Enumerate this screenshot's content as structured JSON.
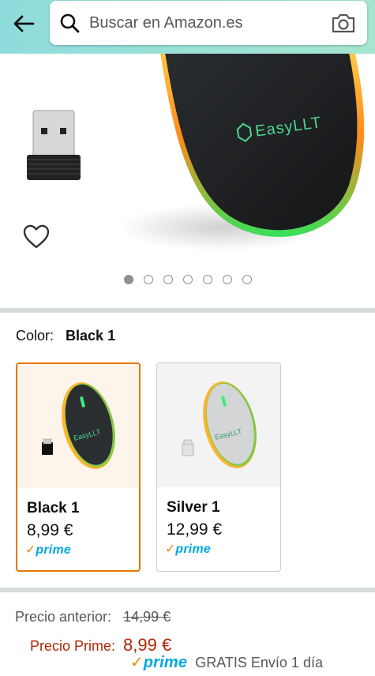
{
  "header": {
    "search_placeholder": "Buscar en Amazon.es"
  },
  "gallery": {
    "image_count": 7,
    "active_index": 0,
    "brand_mark": "EasyLLT"
  },
  "color": {
    "label": "Color:",
    "selected": "Black 1"
  },
  "variants": [
    {
      "name": "Black 1",
      "price": "8,99 €",
      "prime": "prime",
      "selected": true
    },
    {
      "name": "Silver 1",
      "price": "12,99 €",
      "prime": "prime",
      "selected": false
    }
  ],
  "pricing": {
    "old_label": "Precio anterior:",
    "old_value": "14,99 €",
    "prime_label": "Precio Prime:",
    "prime_value": "8,99 €",
    "prime_word": "prime",
    "shipping": "GRATIS Envío 1 día"
  },
  "colors": {
    "header_start": "#8fdcdc",
    "header_end": "#a6e6d0",
    "selected_border": "#e77600",
    "price_red": "#b12704",
    "prime_blue": "#00a8e1",
    "prime_orange": "#f08804"
  },
  "icons": [
    "back-arrow-icon",
    "search-icon",
    "camera-icon",
    "heart-icon"
  ]
}
